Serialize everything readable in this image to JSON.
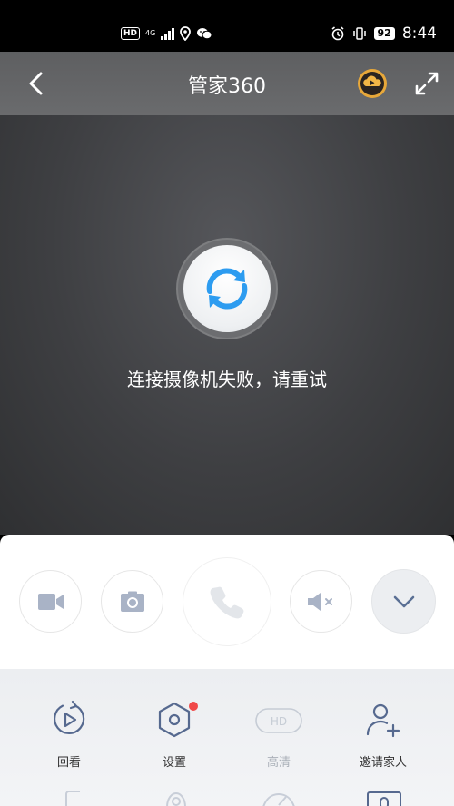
{
  "status_bar": {
    "hd": "HD",
    "network": "4G",
    "network_sub": "+",
    "battery": "92",
    "time": "8:44"
  },
  "header": {
    "title": "管家360",
    "back_icon": "chevron-left-icon",
    "cloud_icon": "cloud-play-icon",
    "expand_icon": "fullscreen-icon"
  },
  "video": {
    "error_message": "连接摄像机失败，请重试",
    "retry_icon": "refresh-icon"
  },
  "controls": [
    {
      "icon": "video-record-icon"
    },
    {
      "icon": "camera-snapshot-icon"
    },
    {
      "icon": "phone-call-icon"
    },
    {
      "icon": "speaker-mute-icon"
    },
    {
      "icon": "chevron-down-icon"
    }
  ],
  "features": [
    {
      "label": "回看",
      "icon": "playback-icon"
    },
    {
      "label": "设置",
      "icon": "settings-hex-icon",
      "badge": true
    },
    {
      "label": "高清",
      "icon": "hd-badge-icon",
      "icon_text": "HD",
      "disabled": true
    },
    {
      "label": "邀请家人",
      "icon": "add-user-icon"
    }
  ],
  "colors": {
    "accent_blue": "#2d9cf0",
    "badge_red": "#f04848",
    "header_bg": "#616264",
    "video_bg": "#3e3f42"
  }
}
